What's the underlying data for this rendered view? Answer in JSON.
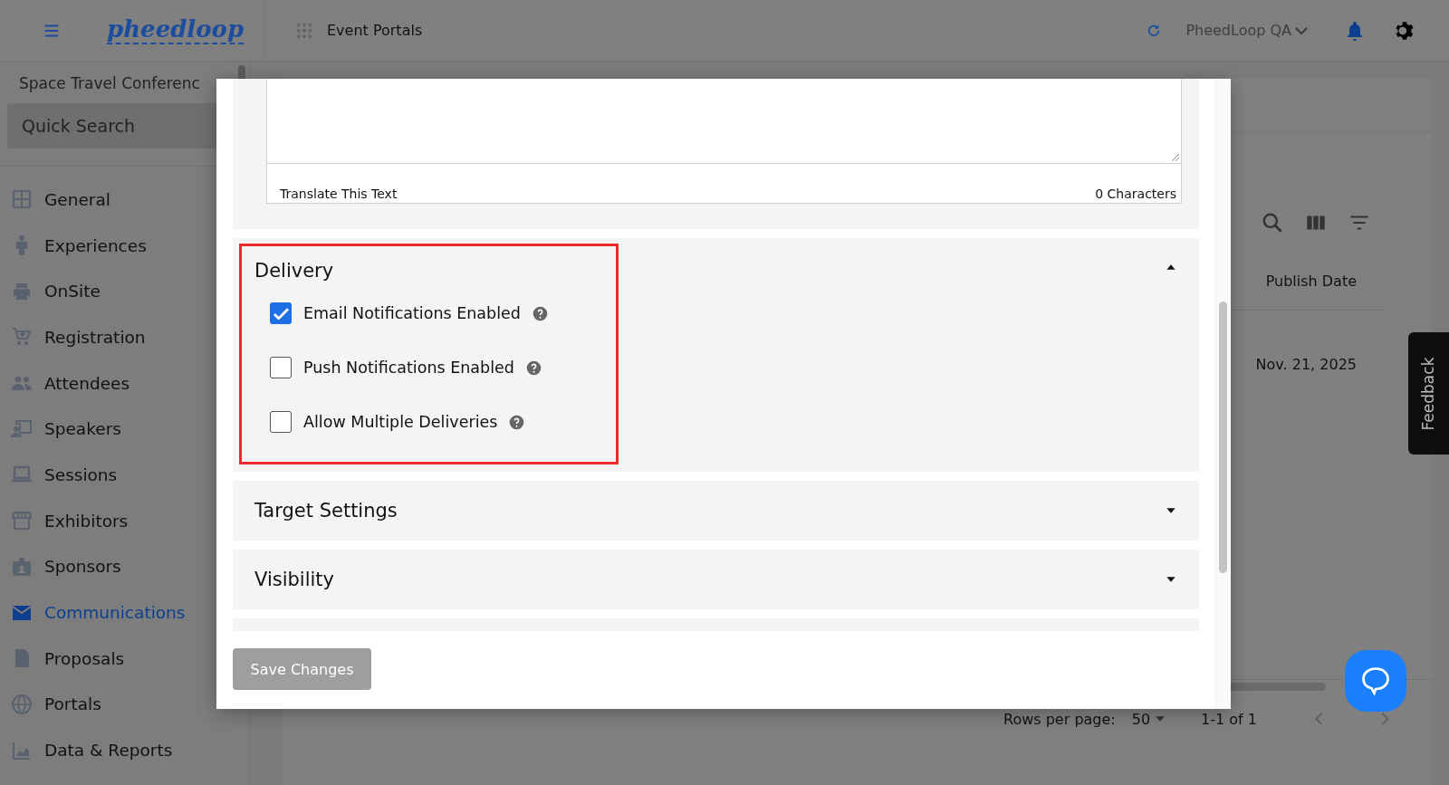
{
  "topbar": {
    "logo": "pheedloop",
    "title": "Event Portals",
    "account": "PheedLoop QA"
  },
  "sidebar": {
    "event_name": "Space Travel Conferenc",
    "search": {
      "placeholder": "Quick Search"
    },
    "items": [
      {
        "label": "General",
        "selected": false
      },
      {
        "label": "Experiences",
        "selected": false
      },
      {
        "label": "OnSite",
        "selected": false
      },
      {
        "label": "Registration",
        "selected": false
      },
      {
        "label": "Attendees",
        "selected": false
      },
      {
        "label": "Speakers",
        "selected": false
      },
      {
        "label": "Sessions",
        "selected": false
      },
      {
        "label": "Exhibitors",
        "selected": false
      },
      {
        "label": "Sponsors",
        "selected": false
      },
      {
        "label": "Communications",
        "selected": true
      },
      {
        "label": "Proposals",
        "selected": false
      },
      {
        "label": "Portals",
        "selected": false
      },
      {
        "label": "Data & Reports",
        "selected": false
      }
    ]
  },
  "table": {
    "columns": [
      "Publish Date"
    ],
    "rows": [
      [
        "Nov. 21, 2025"
      ]
    ],
    "footer": {
      "rows_per_page_label": "Rows per page:",
      "rows_per_page": "50",
      "range": "1-1 of 1"
    }
  },
  "feedback": "Feedback",
  "modal": {
    "textarea_footer": {
      "left": "Translate This Text",
      "right": "0 Characters"
    },
    "sections": [
      {
        "title": "Delivery",
        "expanded": true,
        "highlighted": true,
        "options": [
          {
            "label": "Email Notifications Enabled",
            "checked": true
          },
          {
            "label": "Push Notifications Enabled",
            "checked": false
          },
          {
            "label": "Allow Multiple Deliveries",
            "checked": false
          }
        ]
      },
      {
        "title": "Target Settings",
        "expanded": false
      },
      {
        "title": "Visibility",
        "expanded": false
      }
    ],
    "save_button": {
      "label": "Save Changes",
      "disabled": true
    }
  }
}
